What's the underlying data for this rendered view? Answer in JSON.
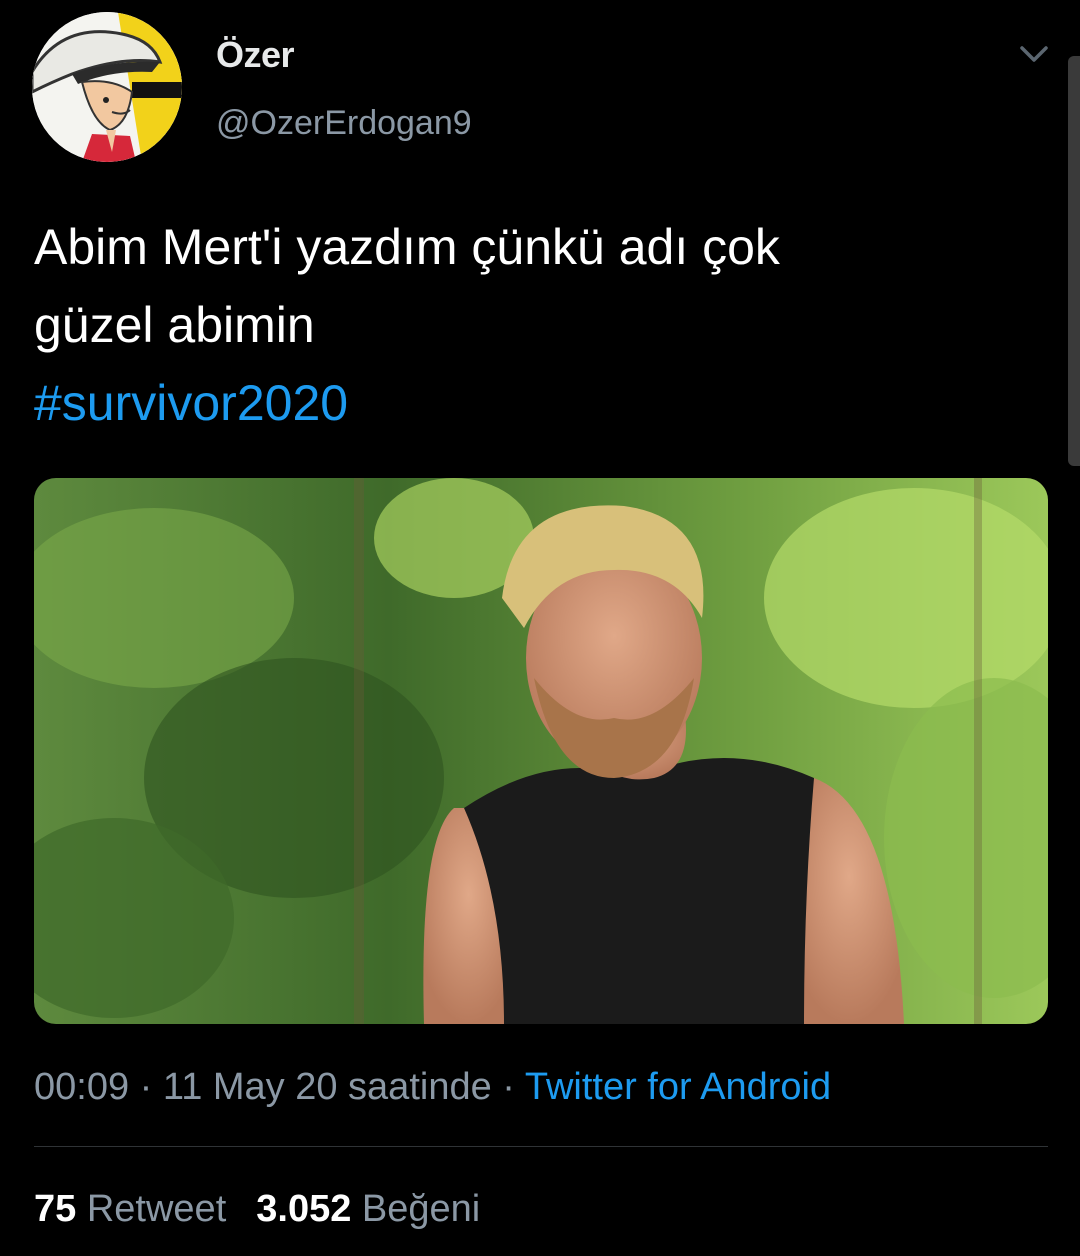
{
  "user": {
    "display_name": "Özer",
    "handle": "@OzerErdogan9",
    "avatar_icon": "cartoon-cowboy-avatar"
  },
  "tweet": {
    "text_line1": "Abim Mert'i yazdım çünkü adı çok",
    "text_line2": "güzel abimin",
    "hashtag": "#survivor2020"
  },
  "media": {
    "kind": "photo"
  },
  "meta": {
    "time": "00:09",
    "sep1": " · ",
    "date": "11 May 20 saatinde",
    "sep2": " · ",
    "source": "Twitter for Android"
  },
  "stats": {
    "retweet_count": "75",
    "retweet_label": "Retweet",
    "like_count": "3.052",
    "like_label": "Beğeni"
  },
  "colors": {
    "background": "#000000",
    "link": "#1d9bf0",
    "secondary_text": "#8b98a5"
  }
}
